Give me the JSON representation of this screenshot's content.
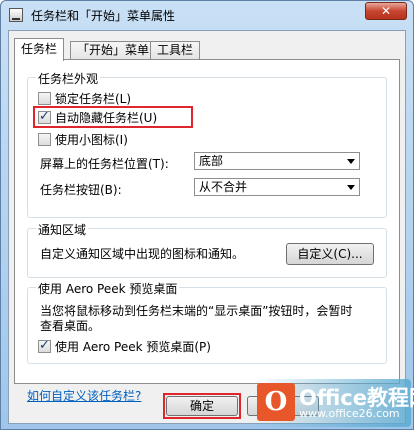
{
  "window": {
    "title": "任务栏和「开始」菜单属性",
    "close_glyph": "✕"
  },
  "tabs": [
    {
      "label": "任务栏",
      "active": true
    },
    {
      "label": "「开始」菜单",
      "active": false
    },
    {
      "label": "工具栏",
      "active": false
    }
  ],
  "appearance": {
    "title": "任务栏外观",
    "lock": {
      "label": "锁定任务栏(L)",
      "checked": false
    },
    "autohide": {
      "label": "自动隐藏任务栏(U)",
      "checked": true
    },
    "small_icons": {
      "label": "使用小图标(I)",
      "checked": false
    },
    "position_label": "屏幕上的任务栏位置(T):",
    "position_value": "底部",
    "buttons_label": "任务栏按钮(B):",
    "buttons_value": "从不合并"
  },
  "notification": {
    "title": "通知区域",
    "description": "自定义通知区域中出现的图标和通知。",
    "customize_button": "自定义(C)..."
  },
  "aero": {
    "title": "使用 Aero Peek 预览桌面",
    "description_line1": "当您将鼠标移动到任务栏末端的“显示桌面”按钮时，会暂时",
    "description_line2": "查看桌面。",
    "checkbox": {
      "label": "使用 Aero Peek 预览桌面(P)",
      "checked": true
    }
  },
  "help_link": "如何自定义该任务栏?",
  "footer": {
    "ok_button": "确定",
    "cancel_partial": "取消"
  },
  "watermark": {
    "logo_letter": "O",
    "title": "Office教程网",
    "url": "www.office26.com"
  },
  "colors": {
    "highlight_red": "#e0262a",
    "link_blue": "#0060c0",
    "title_bar": "#c9e0f5"
  }
}
